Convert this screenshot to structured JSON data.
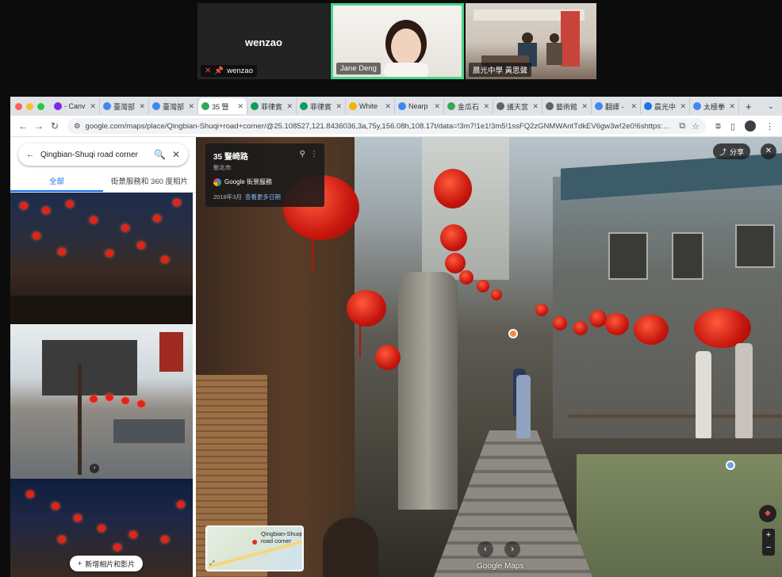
{
  "call": {
    "tile1": {
      "big_name": "wenzao",
      "label": "wenzao"
    },
    "tile2": {
      "label": "Jane Deng"
    },
    "tile3": {
      "label": "晨光中學 黃思聲"
    }
  },
  "browser": {
    "tabs": [
      {
        "label": "- Canv",
        "fav_color": "#7d2ae8"
      },
      {
        "label": "臺灣部",
        "fav_color": "#4285f4"
      },
      {
        "label": "臺灣部",
        "fav_color": "#4285f4"
      },
      {
        "label": "35 豎",
        "fav_color": "#34a853",
        "active": true
      },
      {
        "label": "菲律賓",
        "fav_color": "#0f9d58"
      },
      {
        "label": "菲律賓",
        "fav_color": "#0f9d58"
      },
      {
        "label": "White",
        "fav_color": "#f4b400"
      },
      {
        "label": "Nearp",
        "fav_color": "#4285f4"
      },
      {
        "label": "金瓜石",
        "fav_color": "#34a853"
      },
      {
        "label": "議天宮",
        "fav_color": "#5f6368"
      },
      {
        "label": "藝術館",
        "fav_color": "#5f6368"
      },
      {
        "label": "翻譯 -",
        "fav_color": "#4285f4"
      },
      {
        "label": "晨光中",
        "fav_color": "#1a73e8"
      },
      {
        "label": "太極拳",
        "fav_color": "#4285f4"
      }
    ],
    "url": "google.com/maps/place/Qingbian-Shuqi+road+corner/@25.108527,121.8436036,3a,75y,156.08h,108.17t/data=!3m7!1e1!3m5!1ssFQ2zGNMWAntTdkEV6gw3w!2e0!6shttps:%2F%2Fstreetviewpixels-pa..."
  },
  "panel": {
    "search_query": "Qingbian-Shuqi road corner",
    "tab_all": "全部",
    "tab_street": "街景服務和 360 度相片",
    "add_photo": "新增相片和影片"
  },
  "streetview": {
    "address": "35 豎崎路",
    "region": "新北市",
    "service": "Google 街景服務",
    "date": "2018年3月",
    "more_dates": "查看更多日期",
    "share": "分享",
    "minimap_label": "Qingbian-Shuqi road corner",
    "logo": "Google Maps"
  },
  "colors": {
    "active_speaker": "#48d48a",
    "maps_blue": "#1a73e8",
    "lantern_red": "#d01a12"
  }
}
